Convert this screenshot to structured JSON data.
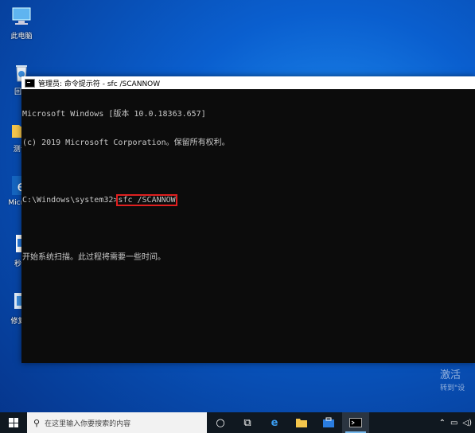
{
  "desktop": {
    "icons": [
      {
        "label": "此电脑"
      },
      {
        "label": "回收"
      },
      {
        "label": "测试i"
      },
      {
        "label": "Micr Ed"
      },
      {
        "label": "秒关"
      },
      {
        "label": "修复开"
      }
    ]
  },
  "cmd": {
    "title": "管理员: 命令提示符 - sfc /SCANNOW",
    "line1": "Microsoft Windows [版本 10.0.18363.657]",
    "line2": "(c) 2019 Microsoft Corporation。保留所有权利。",
    "prompt": "C:\\Windows\\system32>",
    "command": "sfc /SCANNOW",
    "output": "开始系统扫描。此过程将需要一些时间。"
  },
  "watermark": {
    "line1": "激活",
    "line2": "转到\"设"
  },
  "taskbar": {
    "search_placeholder": "在这里输入你要搜索的内容",
    "accent": "#76b9ed"
  }
}
